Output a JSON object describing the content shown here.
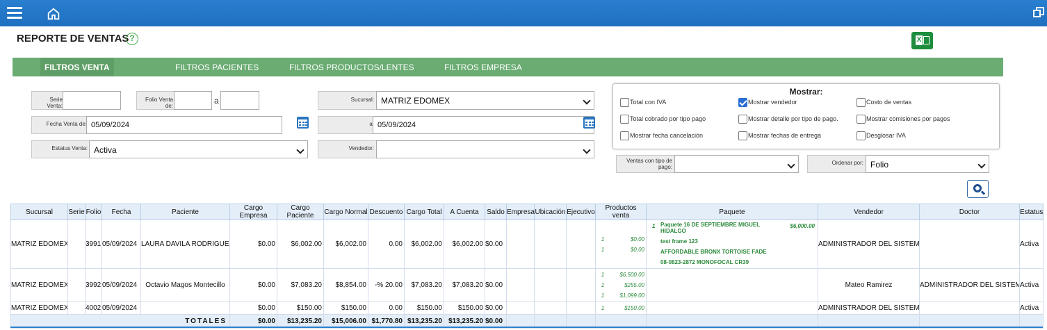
{
  "header": {
    "title": "REPORTE DE VENTAS",
    "help": "?"
  },
  "icons": {
    "menu": "hamburger-icon",
    "home": "home-icon",
    "window": "restore-window-icon",
    "excel": "excel-icon",
    "search": "search-icon",
    "calendar": "calendar-icon"
  },
  "colors": {
    "topbar": "#1f6fbf",
    "tabs": "#6aac72",
    "excel": "#1e8e3e",
    "accent_text": "#2a8a3a"
  },
  "tabs": [
    {
      "label": "FILTROS VENTA"
    },
    {
      "label": "FILTROS PACIENTES"
    },
    {
      "label": "FILTROS PRODUCTOS/LENTES"
    },
    {
      "label": "FILTROS EMPRESA"
    }
  ],
  "filters": {
    "serie_label": "Serie Venta:",
    "serie_value": "",
    "folio_label": "Folio Venta de:",
    "folio_from": "",
    "folio_to_label": "a",
    "folio_to": "",
    "sucursal_label": "Sucursal:",
    "sucursal_value": "MATRIZ EDOMEX",
    "fecha_label": "Fecha Venta de:",
    "fecha_from": "05/09/2024",
    "fecha_to_label": "a:",
    "fecha_to": "05/09/2024",
    "estatus_label": "Estatus Venta:",
    "estatus_value": "Activa",
    "vendedor_label": "Vendedor:",
    "vendedor_value": "",
    "tipo_pago_label": "Ventas con tipo de pago:",
    "tipo_pago_value": "",
    "ordenar_label": "Ordenar por:",
    "ordenar_value": "Folio"
  },
  "mostrar": {
    "title": "Mostrar:",
    "options": [
      {
        "label": "Total con IVA",
        "checked": false
      },
      {
        "label": "Mostrar vendedor",
        "checked": true
      },
      {
        "label": "Costo de ventas",
        "checked": false
      },
      {
        "label": "Total cobrado por tipo pago",
        "checked": false
      },
      {
        "label": "Mostrar detalle por tipo de pago.",
        "checked": false
      },
      {
        "label": "Mostrar comisiones por pagos",
        "checked": false
      },
      {
        "label": "Mostrar fecha cancelación",
        "checked": false
      },
      {
        "label": "Mostrar fechas de entrega",
        "checked": false
      },
      {
        "label": "Desglosar IVA",
        "checked": false
      }
    ]
  },
  "table": {
    "columns": [
      "Sucursal",
      "Serie",
      "Folio",
      "Fecha",
      "Paciente",
      "Cargo Empresa",
      "Cargo Paciente",
      "Cargo Normal",
      "Descuento",
      "Cargo Total",
      "A Cuenta",
      "Saldo",
      "Empresa",
      "Ubicación",
      "Ejecutivo",
      "Productos venta",
      "Paquete",
      "Vendedor",
      "Doctor",
      "Estatus"
    ],
    "rows": [
      {
        "sucursal": "MATRIZ EDOMEX",
        "serie": "",
        "folio": "3991",
        "fecha": "05/09/2024",
        "paciente": "LAURA DAVILA RODRIGUEZ",
        "cargo_empresa": "$0.00",
        "cargo_paciente": "$6,002.00",
        "cargo_normal": "$6,002.00",
        "descuento": "0.00",
        "cargo_total": "$6,002.00",
        "a_cuenta": "$6,002.00",
        "saldo": "$0.00",
        "empresa": "",
        "ubicacion": "",
        "ejecutivo": "",
        "productos": [
          {
            "qty": "1",
            "price": "$0.00"
          },
          {
            "qty": "1",
            "price": "$0.00"
          }
        ],
        "paquete": {
          "qty": "1",
          "name": "Paquete 16 DE SEPTIEMBRE MIGUEL HIDALGO",
          "price": "$6,000.00",
          "items": [
            "test frame 123",
            "AFFORDABLE BRONX TORTOISE FADE",
            "08-0823-2872 MONOFOCAL CR39"
          ]
        },
        "vendedor": "ADMINISTRADOR DEL SISTEMA",
        "doctor": "",
        "estatus": "Activa"
      },
      {
        "sucursal": "MATRIZ EDOMEX",
        "serie": "",
        "folio": "3992",
        "fecha": "05/09/2024",
        "paciente": "Octavio Magos Montecillo",
        "cargo_empresa": "$0.00",
        "cargo_paciente": "$7,083.20",
        "cargo_normal": "$8,854.00",
        "descuento": "-% 20.00",
        "cargo_total": "$7,083.20",
        "a_cuenta": "$7,083.20",
        "saldo": "$0.00",
        "empresa": "",
        "ubicacion": "",
        "ejecutivo": "",
        "productos": [
          {
            "qty": "1",
            "price": "$6,500.00"
          },
          {
            "qty": "1",
            "price": "$255.00"
          },
          {
            "qty": "1",
            "price": "$1,099.00"
          }
        ],
        "vendedor": "Mateo Ramirez",
        "doctor": "ADMINISTRADOR DEL SISTEMA",
        "estatus": "Activa"
      },
      {
        "sucursal": "MATRIZ EDOMEX",
        "serie": "",
        "folio": "4002",
        "fecha": "05/09/2024",
        "paciente": "",
        "cargo_empresa": "$0.00",
        "cargo_paciente": "$150.00",
        "cargo_normal": "$150.00",
        "descuento": "0.00",
        "cargo_total": "$150.00",
        "a_cuenta": "$150.00",
        "saldo": "$0.00",
        "empresa": "",
        "ubicacion": "",
        "ejecutivo": "",
        "productos": [
          {
            "qty": "1",
            "price": "$150.00"
          }
        ],
        "vendedor": "ADMINISTRADOR DEL SISTEMA",
        "doctor": "",
        "estatus": "Activa"
      }
    ],
    "totals": {
      "label": "TOTALES",
      "cargo_empresa": "$0.00",
      "cargo_paciente": "$13,235.20",
      "cargo_normal": "$15,006.00",
      "descuento": "$1,770.80",
      "cargo_total": "$13,235.20",
      "a_cuenta": "$13,235.20",
      "saldo": "$0.00"
    }
  }
}
